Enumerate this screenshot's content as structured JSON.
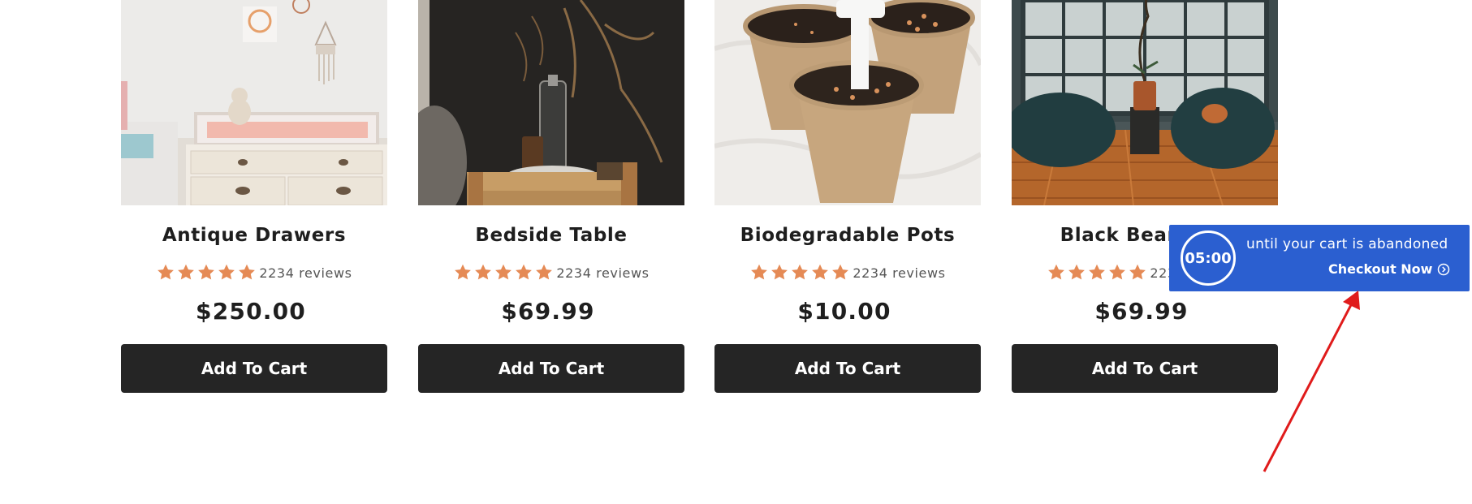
{
  "products": [
    {
      "title": "Antique Drawers",
      "reviews": "2234 reviews",
      "rating": 5,
      "price": "$250.00",
      "button": "Add To Cart"
    },
    {
      "title": "Bedside Table",
      "reviews": "2234 reviews",
      "rating": 5,
      "price": "$69.99",
      "button": "Add To Cart"
    },
    {
      "title": "Biodegradable Pots",
      "reviews": "2234 reviews",
      "rating": 5,
      "price": "$10.00",
      "button": "Add To Cart"
    },
    {
      "title": "Black Bean Bag",
      "reviews": "2234 reviews",
      "rating": 5,
      "price": "$69.99",
      "button": "Add To Cart"
    }
  ],
  "cart_popup": {
    "timer": "05:00",
    "message": "until your cart is abandoned",
    "checkout": "Checkout Now"
  },
  "colors": {
    "star": "#e58a55",
    "button_bg": "#252525",
    "popup_bg": "#2b5fd0",
    "arrow": "#e01b1b"
  }
}
